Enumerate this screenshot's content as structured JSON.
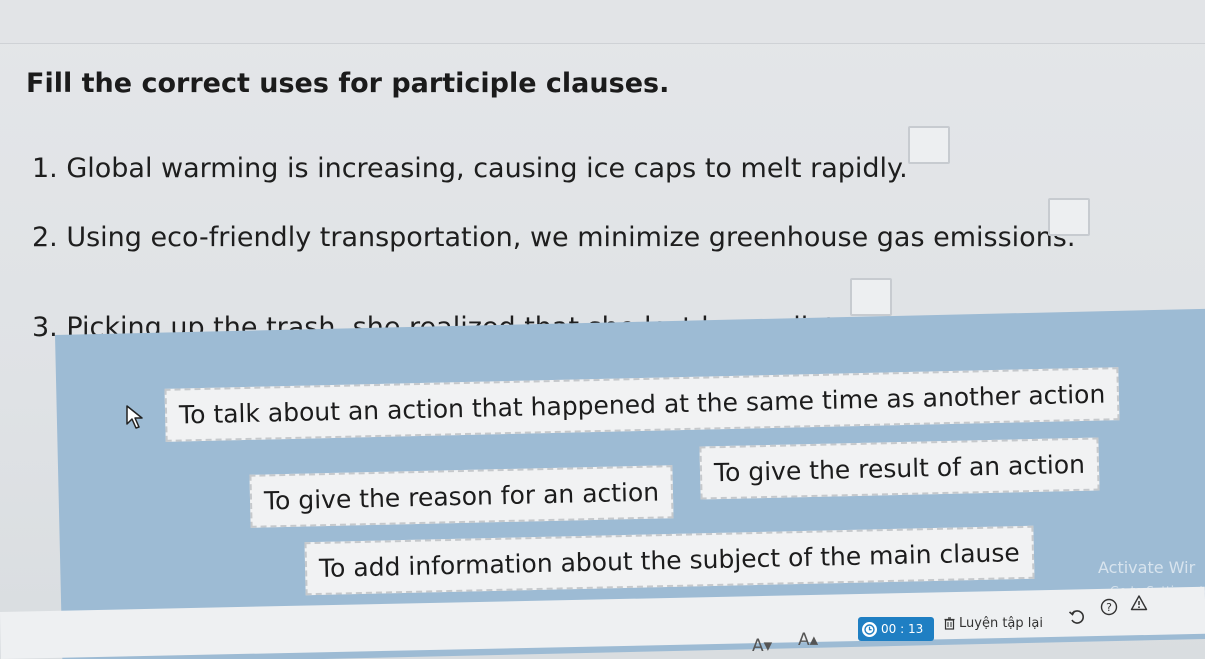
{
  "exercise": {
    "title": "Fill the correct uses for participle clauses.",
    "questions": [
      {
        "text": "1. Global warming is increasing, causing ice caps to melt rapidly."
      },
      {
        "text": "2. Using eco-friendly transportation, we minimize greenhouse gas emissions."
      },
      {
        "text": "3. Picking up the trash, she realized that she lost her wallet."
      }
    ]
  },
  "options": [
    {
      "label": "To talk about an action that happened at the same time as another action"
    },
    {
      "label": "To give the reason for an action"
    },
    {
      "label": "To give the result of an action"
    },
    {
      "label": "To add information about the subject of the main clause"
    }
  ],
  "watermark": {
    "line1": "Activate Wir",
    "line2": "Go to Settings to"
  },
  "toolbar": {
    "font_decrease": "A▾",
    "font_increase": "A▴",
    "timer": "00 : 13",
    "practice_again": "Luyện tập lại"
  },
  "colors": {
    "panel": "#9dbbd4",
    "timer": "#1f7fc3"
  }
}
